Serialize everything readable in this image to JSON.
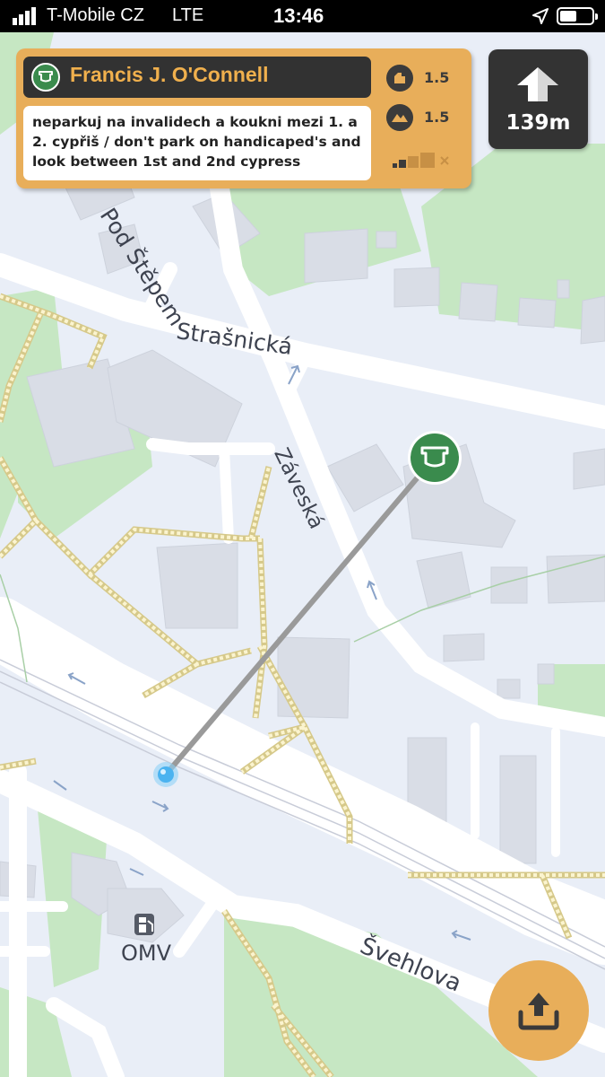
{
  "status_bar": {
    "carrier": "T-Mobile CZ",
    "network": "LTE",
    "time": "13:46"
  },
  "cache": {
    "name": "Francis J. O'Connell",
    "hint": "neparkuj na invalidech a koukni mezi 1. a 2. cypřiš / don't park on handicaped's and look between 1st and 2nd cypress",
    "difficulty": "1.5",
    "terrain": "1.5",
    "icon": "cache-pot-icon"
  },
  "navigation": {
    "distance": "139m",
    "direction_icon": "arrow-up-icon"
  },
  "map": {
    "streets": {
      "pod_stepem": "Pod Štěpem",
      "strasnicka": "Strašnická",
      "zaveska": "Záveská",
      "svehlova": "Švehlova"
    },
    "poi": {
      "gas_station": "OMV"
    }
  },
  "buttons": {
    "share_icon": "share-upload-icon"
  },
  "colors": {
    "accent": "#e8ae5a",
    "card_header": "#323232",
    "cache_green": "#3a8b4d",
    "map_background": "#e9eef7",
    "road": "#ffffff",
    "footpath": "#f3e6a0",
    "greenery": "#c6e7c3",
    "building": "#d9dde6"
  }
}
